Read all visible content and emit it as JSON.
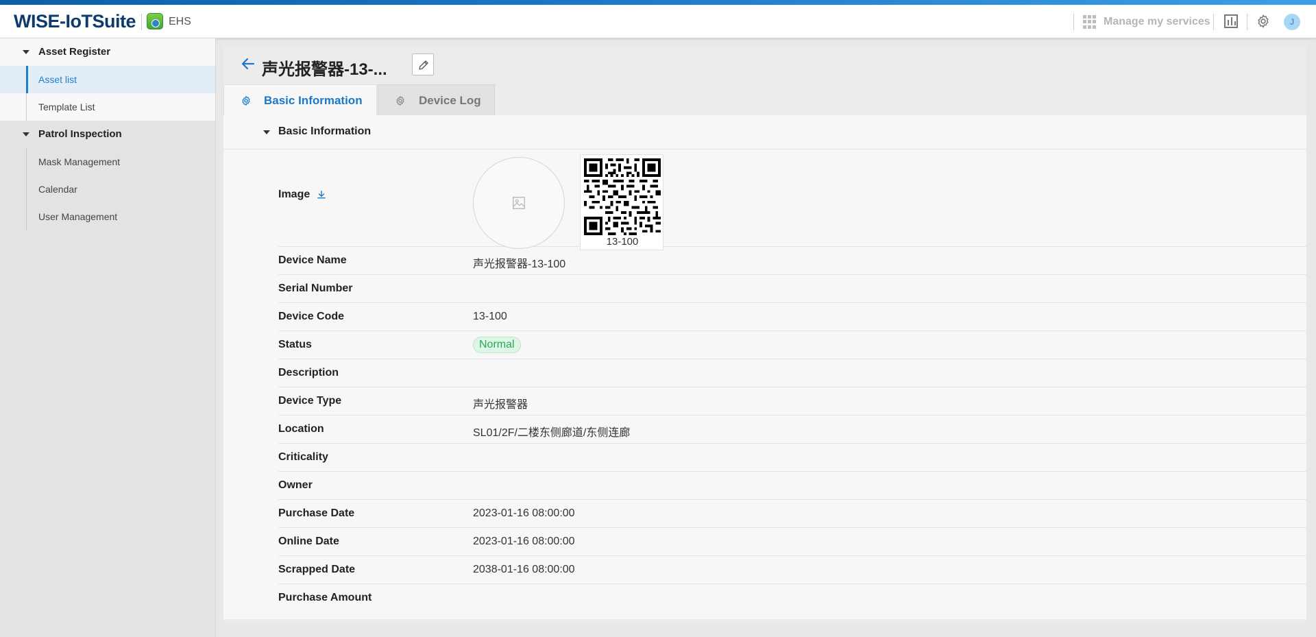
{
  "header": {
    "logo": "WISE-IoTSuite",
    "app_name": "EHS",
    "manage_services": "Manage my services",
    "avatar_initial": "J"
  },
  "sidebar": {
    "groups": [
      {
        "label": "Asset Register",
        "items": [
          "Asset list",
          "Template List"
        ]
      },
      {
        "label": "Patrol Inspection",
        "items": [
          "Mask Management",
          "Calendar",
          "User Management"
        ]
      }
    ]
  },
  "page": {
    "title": "声光报警器-13-...",
    "tabs": [
      {
        "label": "Basic Information",
        "active": true
      },
      {
        "label": "Device Log",
        "active": false
      }
    ],
    "section_title": "Basic Information",
    "image_label": "Image",
    "qr_caption": "13-100",
    "fields": [
      {
        "label": "Device Name",
        "value": "声光报警器-13-100"
      },
      {
        "label": "Serial Number",
        "value": ""
      },
      {
        "label": "Device Code",
        "value": "13-100"
      },
      {
        "label": "Status",
        "value": "Normal",
        "badge": true
      },
      {
        "label": "Description",
        "value": ""
      },
      {
        "label": "Device Type",
        "value": "声光报警器"
      },
      {
        "label": "Location",
        "value": "SL01/2F/二楼东侧廊道/东侧连廊"
      },
      {
        "label": "Criticality",
        "value": ""
      },
      {
        "label": "Owner",
        "value": ""
      },
      {
        "label": "Purchase Date",
        "value": "2023-01-16 08:00:00"
      },
      {
        "label": "Online Date",
        "value": "2023-01-16 08:00:00"
      },
      {
        "label": "Scrapped Date",
        "value": "2038-01-16 08:00:00"
      },
      {
        "label": "Purchase Amount",
        "value": ""
      }
    ]
  },
  "colors": {
    "accent": "#1b78c8",
    "logo": "#0d3b70",
    "status_normal": "#2aa955"
  },
  "icons": {
    "back": "arrow-left-icon",
    "edit": "pencil-icon",
    "tab": "gear-icon",
    "download": "download-icon",
    "image_placeholder": "image-placeholder-icon"
  }
}
